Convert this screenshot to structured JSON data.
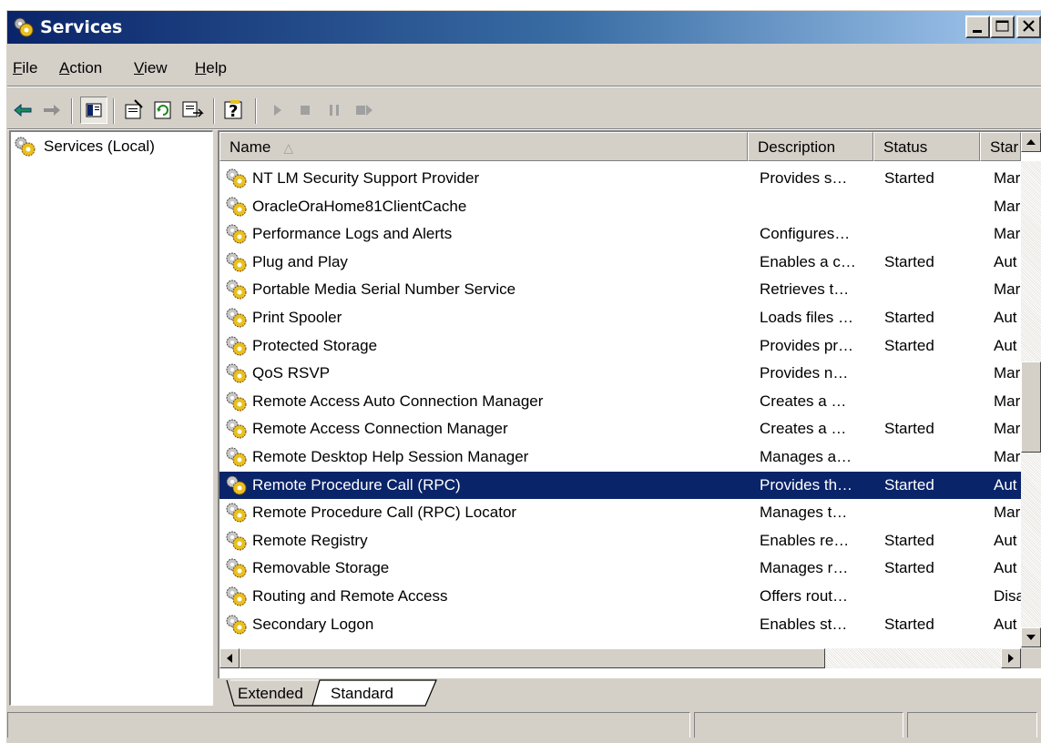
{
  "window": {
    "title": "Services",
    "buttons": [
      "minimize",
      "maximize",
      "close"
    ]
  },
  "menu": {
    "items": [
      {
        "label": "File",
        "accel": "F",
        "rest": "ile"
      },
      {
        "label": "Action",
        "accel": "A",
        "rest": "ction"
      },
      {
        "label": "View",
        "accel": "V",
        "rest": "iew"
      },
      {
        "label": "Help",
        "accel": "H",
        "rest": "elp"
      }
    ]
  },
  "toolbar": {
    "icons": [
      "back-arrow-icon",
      "forward-arrow-icon",
      "show-hide-tree-icon",
      "properties-icon",
      "refresh-icon",
      "export-list-icon",
      "help-icon",
      "start-service-icon",
      "stop-service-icon",
      "pause-service-icon",
      "restart-service-icon"
    ]
  },
  "tree": {
    "root_label": "Services (Local)"
  },
  "list": {
    "columns": [
      "Name",
      "Description",
      "Status",
      "Star"
    ],
    "sort_indicator": "△",
    "rows": [
      {
        "name": "NT LM Security Support Provider",
        "description": "Provides s…",
        "status": "Started",
        "startup": "Mar"
      },
      {
        "name": "OracleOraHome81ClientCache",
        "description": "",
        "status": "",
        "startup": "Mar"
      },
      {
        "name": "Performance Logs and Alerts",
        "description": "Configures…",
        "status": "",
        "startup": "Mar"
      },
      {
        "name": "Plug and Play",
        "description": "Enables a c…",
        "status": "Started",
        "startup": "Aut"
      },
      {
        "name": "Portable Media Serial Number Service",
        "description": "Retrieves t…",
        "status": "",
        "startup": "Mar"
      },
      {
        "name": "Print Spooler",
        "description": "Loads files …",
        "status": "Started",
        "startup": "Aut"
      },
      {
        "name": "Protected Storage",
        "description": "Provides pr…",
        "status": "Started",
        "startup": "Aut"
      },
      {
        "name": "QoS RSVP",
        "description": "Provides n…",
        "status": "",
        "startup": "Mar"
      },
      {
        "name": "Remote Access Auto Connection Manager",
        "description": "Creates a …",
        "status": "",
        "startup": "Mar"
      },
      {
        "name": "Remote Access Connection Manager",
        "description": "Creates a …",
        "status": "Started",
        "startup": "Mar"
      },
      {
        "name": "Remote Desktop Help Session Manager",
        "description": "Manages a…",
        "status": "",
        "startup": "Mar"
      },
      {
        "name": "Remote Procedure Call (RPC)",
        "description": "Provides th…",
        "status": "Started",
        "startup": "Aut",
        "selected": true
      },
      {
        "name": "Remote Procedure Call (RPC) Locator",
        "description": "Manages t…",
        "status": "",
        "startup": "Mar"
      },
      {
        "name": "Remote Registry",
        "description": "Enables re…",
        "status": "Started",
        "startup": "Aut"
      },
      {
        "name": "Removable Storage",
        "description": "Manages r…",
        "status": "Started",
        "startup": "Aut"
      },
      {
        "name": "Routing and Remote Access",
        "description": "Offers rout…",
        "status": "",
        "startup": "Disa"
      },
      {
        "name": "Secondary Logon",
        "description": "Enables st…",
        "status": "Started",
        "startup": "Aut"
      }
    ]
  },
  "tabs": [
    {
      "label": "Extended",
      "active": false
    },
    {
      "label": "Standard",
      "active": true
    }
  ],
  "colors": {
    "selection": "#0a246a",
    "face": "#d4d0c8",
    "title_start": "#0a246a",
    "title_end": "#a6caf0"
  }
}
